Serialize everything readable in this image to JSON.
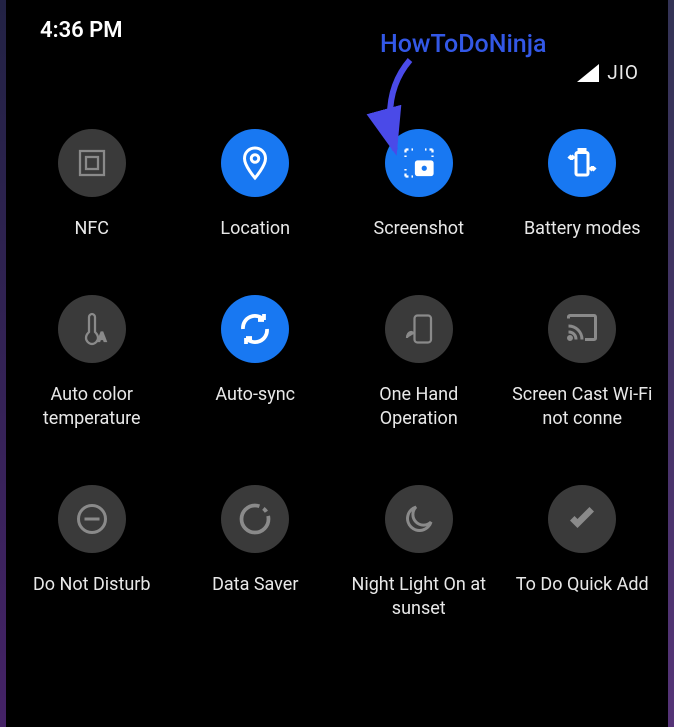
{
  "statusBar": {
    "time": "4:36 PM",
    "carrier": "JIO"
  },
  "watermark": {
    "text": "HowToDoNinja"
  },
  "tiles": {
    "nfc": {
      "label": "NFC",
      "state": "inactive"
    },
    "location": {
      "label": "Location",
      "state": "active"
    },
    "screenshot": {
      "label": "Screenshot",
      "state": "active"
    },
    "battery": {
      "label": "Battery modes",
      "state": "active"
    },
    "autocolor": {
      "label": "Auto color temperature",
      "state": "inactive"
    },
    "autosync": {
      "label": "Auto-sync",
      "state": "active"
    },
    "onehand": {
      "label": "One Hand Operation",
      "state": "inactive"
    },
    "screencast": {
      "label": "Screen Cast Wi-Fi not conne",
      "state": "inactive"
    },
    "dnd": {
      "label": "Do Not Disturb",
      "state": "inactive"
    },
    "datasaver": {
      "label": "Data Saver",
      "state": "inactive"
    },
    "nightlight": {
      "label": "Night Light On at sunset",
      "state": "inactive"
    },
    "todo": {
      "label": "To Do Quick Add",
      "state": "inactive"
    }
  }
}
